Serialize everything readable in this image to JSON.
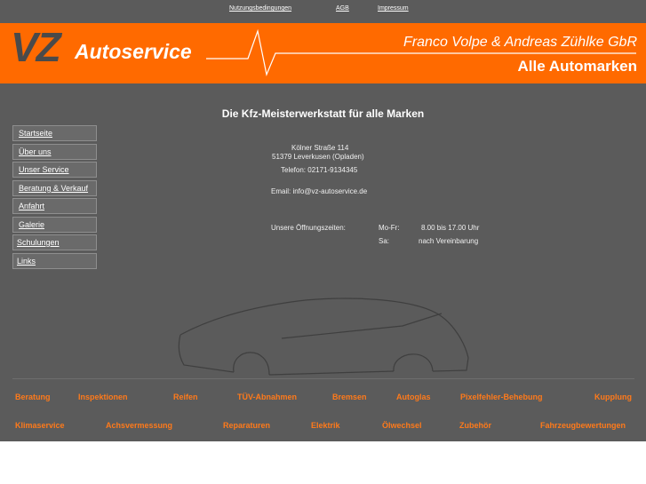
{
  "top_links": [
    "Nutzungsbedingungen",
    "AGB",
    "Impressum"
  ],
  "banner": {
    "logo_vz": "VZ",
    "logo_name": "Autoservice",
    "owners": "Franco Volpe & Andreas Zühlke GbR",
    "tagline": "Alle Automarken"
  },
  "headline": "Die Kfz-Meisterwerkstatt für alle Marken",
  "nav": [
    "Startseite",
    "Über uns",
    "Unser Service",
    "Beratung & Verkauf",
    "Anfahrt",
    "Galerie",
    "Schulungen",
    "Links"
  ],
  "contact": {
    "street": "Kölner Straße 114",
    "city": "51379 Leverkusen (Opladen)",
    "phone": "Telefon: 02171-9134345",
    "email": "Email: info@vz-autoservice.de"
  },
  "hours": {
    "label": "Unsere Öffnungszeiten:",
    "row1_day": "Mo-Fr:",
    "row1_time": "8.00 bis 17.00 Uhr",
    "row2_day": "Sa:",
    "row2_time": "nach Vereinbarung"
  },
  "services_row1": [
    "Beratung",
    "Inspektionen",
    "Reifen",
    "TÜV-Abnahmen",
    "Bremsen",
    "Autoglas",
    "Pixelfehler-Behebung",
    "Kupplung"
  ],
  "services_row2": [
    "Klimaservice",
    "Achsvermessung",
    "Reparaturen",
    "Elektrik",
    "Ölwechsel",
    "Zubehör",
    "Fahrzeugbewertungen"
  ],
  "colors": {
    "accent": "#ff6a00",
    "background": "#5b5b5b",
    "service_text": "#ff7a1a"
  }
}
